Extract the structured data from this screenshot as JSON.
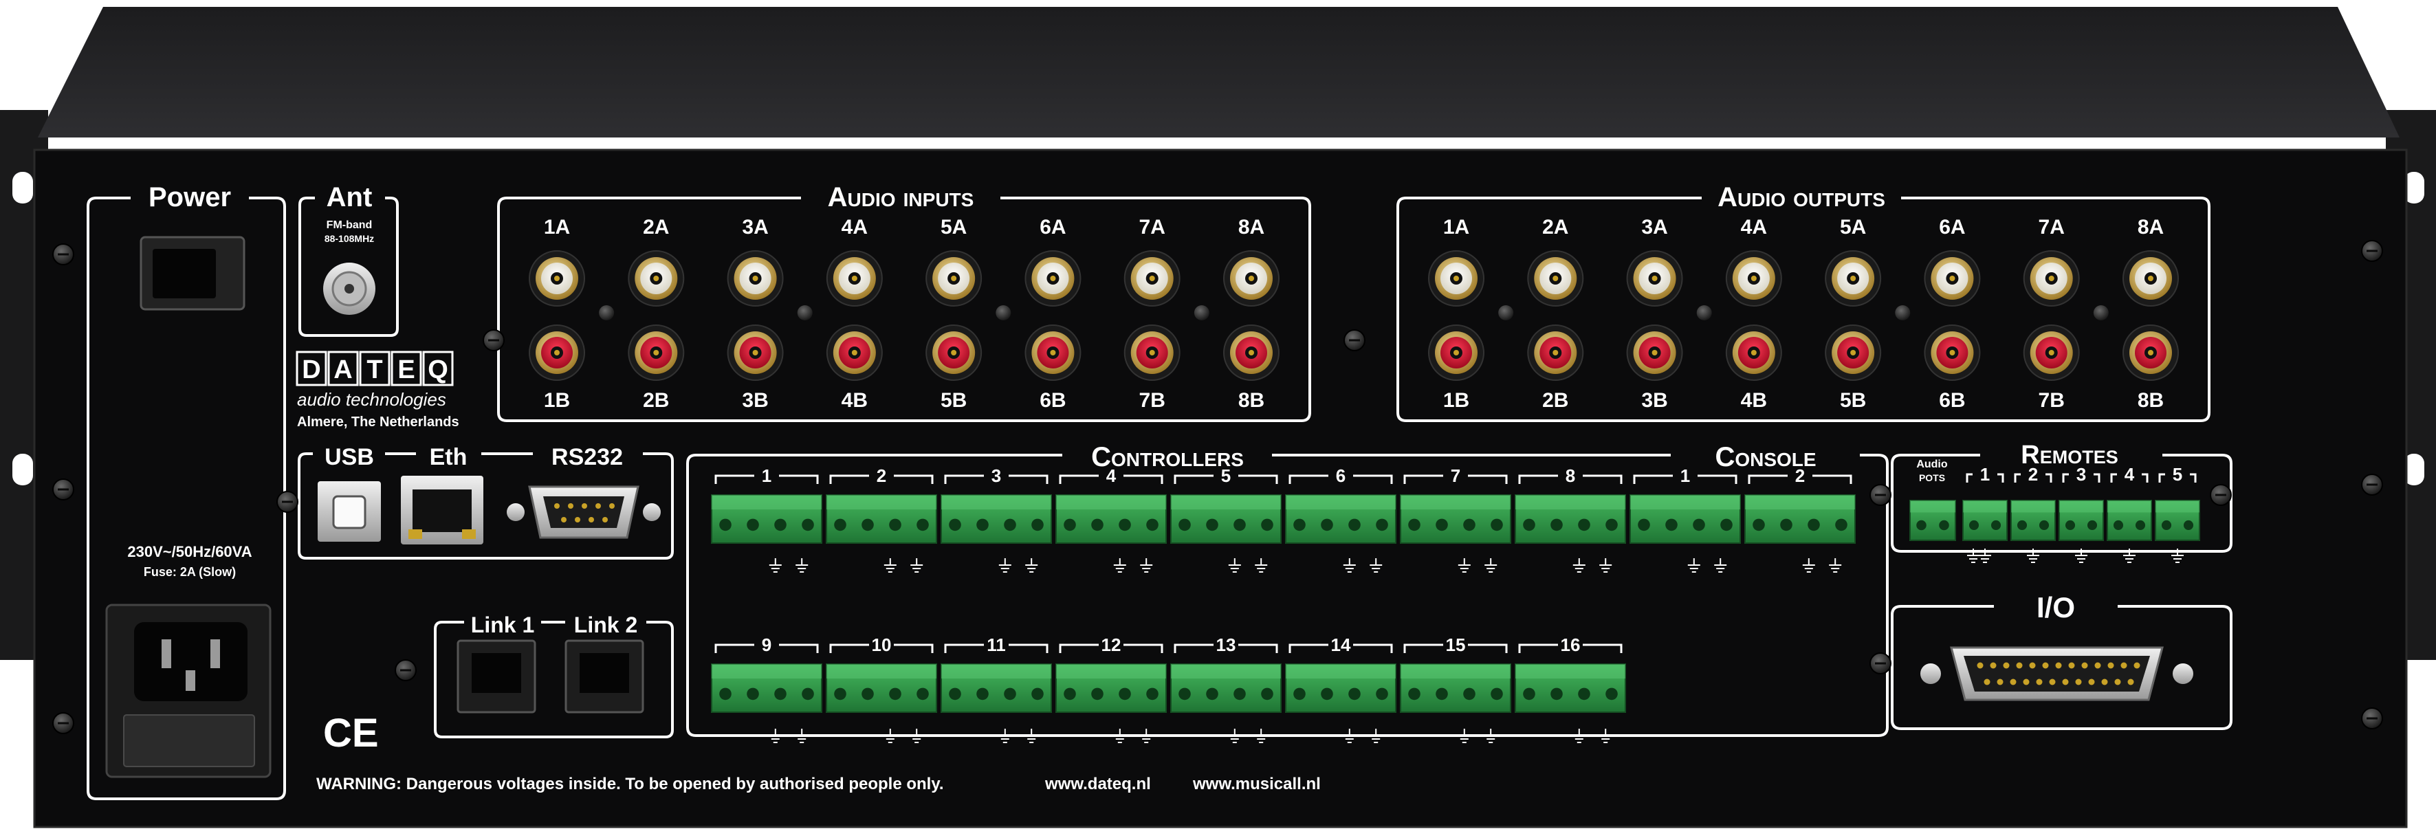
{
  "power": {
    "title": "Power",
    "rating": "230V~/50Hz/60VA",
    "fuse": "Fuse: 2A (Slow)"
  },
  "antenna": {
    "title": "Ant",
    "band": "FM-band",
    "freq": "88-108MHz"
  },
  "brand": {
    "name": "DATEQ",
    "tagline": "audio technologies",
    "location": "Almere, The Netherlands"
  },
  "audio_inputs": {
    "title": "Audio inputs",
    "top": [
      "1A",
      "2A",
      "3A",
      "4A",
      "5A",
      "6A",
      "7A",
      "8A"
    ],
    "bottom": [
      "1B",
      "2B",
      "3B",
      "4B",
      "5B",
      "6B",
      "7B",
      "8B"
    ]
  },
  "audio_outputs": {
    "title": "Audio outputs",
    "top": [
      "1A",
      "2A",
      "3A",
      "4A",
      "5A",
      "6A",
      "7A",
      "8A"
    ],
    "bottom": [
      "1B",
      "2B",
      "3B",
      "4B",
      "5B",
      "6B",
      "7B",
      "8B"
    ]
  },
  "ports": {
    "usb": "USB",
    "eth": "Eth",
    "rs232": "RS232",
    "link1": "Link 1",
    "link2": "Link 2"
  },
  "controllers": {
    "title": "Controllers",
    "row1": [
      "1",
      "2",
      "3",
      "4",
      "5",
      "6",
      "7",
      "8"
    ],
    "row2": [
      "9",
      "10",
      "11",
      "12",
      "13",
      "14",
      "15",
      "16"
    ]
  },
  "console": {
    "title": "Console",
    "labels": [
      "1",
      "2"
    ]
  },
  "remotes": {
    "title": "Remotes",
    "audio": "Audio",
    "pots": "POTS",
    "labels": [
      "1",
      "2",
      "3",
      "4",
      "5"
    ]
  },
  "io": {
    "title": "I/O"
  },
  "footer": {
    "warning": "WARNING: Dangerous voltages inside. To be opened by authorised people only.",
    "url1": "www.dateq.nl",
    "url2": "www.musicall.nl"
  },
  "ce_mark": "CE",
  "colors": {
    "panel": "#0b0b0c",
    "silkscreen": "#ffffff",
    "rca_red": "#c8102e",
    "rca_white": "#f2f2ea",
    "terminal_green": "#2e9a46",
    "brand": "#2a4a9a"
  }
}
